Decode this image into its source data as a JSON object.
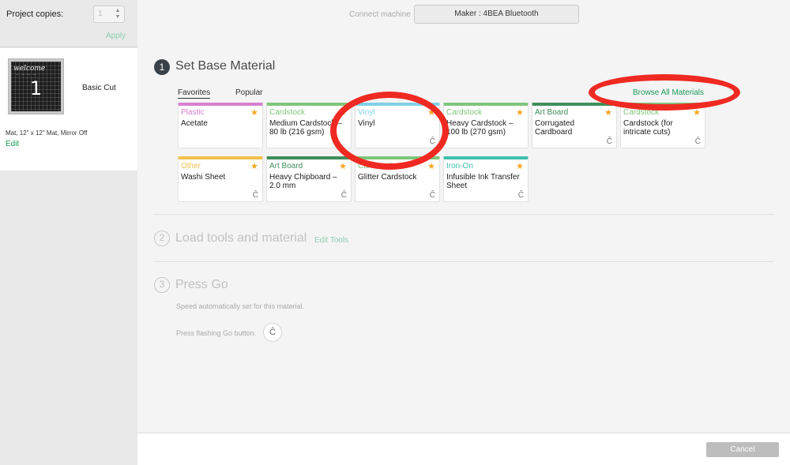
{
  "sidebar": {
    "copies_label": "Project copies:",
    "copies_value": "1",
    "apply_label": "Apply",
    "mat": {
      "number": "1",
      "art_text": "welcome",
      "cut_label": "Basic Cut",
      "info": "Mat, 12\" x 12\" Mat, Mirror Off",
      "edit_label": "Edit"
    }
  },
  "header": {
    "connect_label": "Connect machine",
    "machine": "Maker : 4BEA Bluetooth"
  },
  "steps": {
    "step1": {
      "number": "1",
      "title": "Set Base Material"
    },
    "step2": {
      "number": "2",
      "title": "Load tools and material",
      "edit_tools": "Edit Tools"
    },
    "step3": {
      "number": "3",
      "title": "Press Go",
      "speed_text": "Speed automatically set for this material.",
      "press_text": "Press flashing Go button."
    }
  },
  "tabs": {
    "favorites": "Favorites",
    "popular": "Popular"
  },
  "browse_all": "Browse All Materials",
  "materials": [
    {
      "category": "Plastic",
      "name": "Acetate",
      "color": "#d97fd0",
      "icon": false
    },
    {
      "category": "Cardstock",
      "name": "Medium Cardstock – 80 lb (216 gsm)",
      "color": "#7fc67a",
      "icon": false
    },
    {
      "category": "Vinyl",
      "name": "Vinyl",
      "color": "#7fd0e6",
      "icon": true
    },
    {
      "category": "Cardstock",
      "name": "Heavy Cardstock – 100 lb (270 gsm)",
      "color": "#7fc67a",
      "icon": false
    },
    {
      "category": "Art Board",
      "name": "Corrugated Cardboard",
      "color": "#3f8f5a",
      "icon": true
    },
    {
      "category": "Cardstock",
      "name": "Cardstock (for intricate cuts)",
      "color": "#7fc67a",
      "icon": true
    },
    {
      "category": "Other",
      "name": "Washi Sheet",
      "color": "#f2c14e",
      "icon": true
    },
    {
      "category": "Art Board",
      "name": "Heavy Chipboard – 2.0 mm",
      "color": "#3f8f5a",
      "icon": true
    },
    {
      "category": "Cardstock",
      "name": "Glitter Cardstock",
      "color": "#7fc67a",
      "icon": true
    },
    {
      "category": "Iron-On",
      "name": "Infusible Ink Transfer Sheet",
      "color": "#3fbfae",
      "icon": true
    }
  ],
  "footer": {
    "cancel_label": "Cancel"
  },
  "colors": {
    "accent_green": "#1a9b5a",
    "annotation_red": "#ef2a22",
    "star": "#f3a623"
  }
}
